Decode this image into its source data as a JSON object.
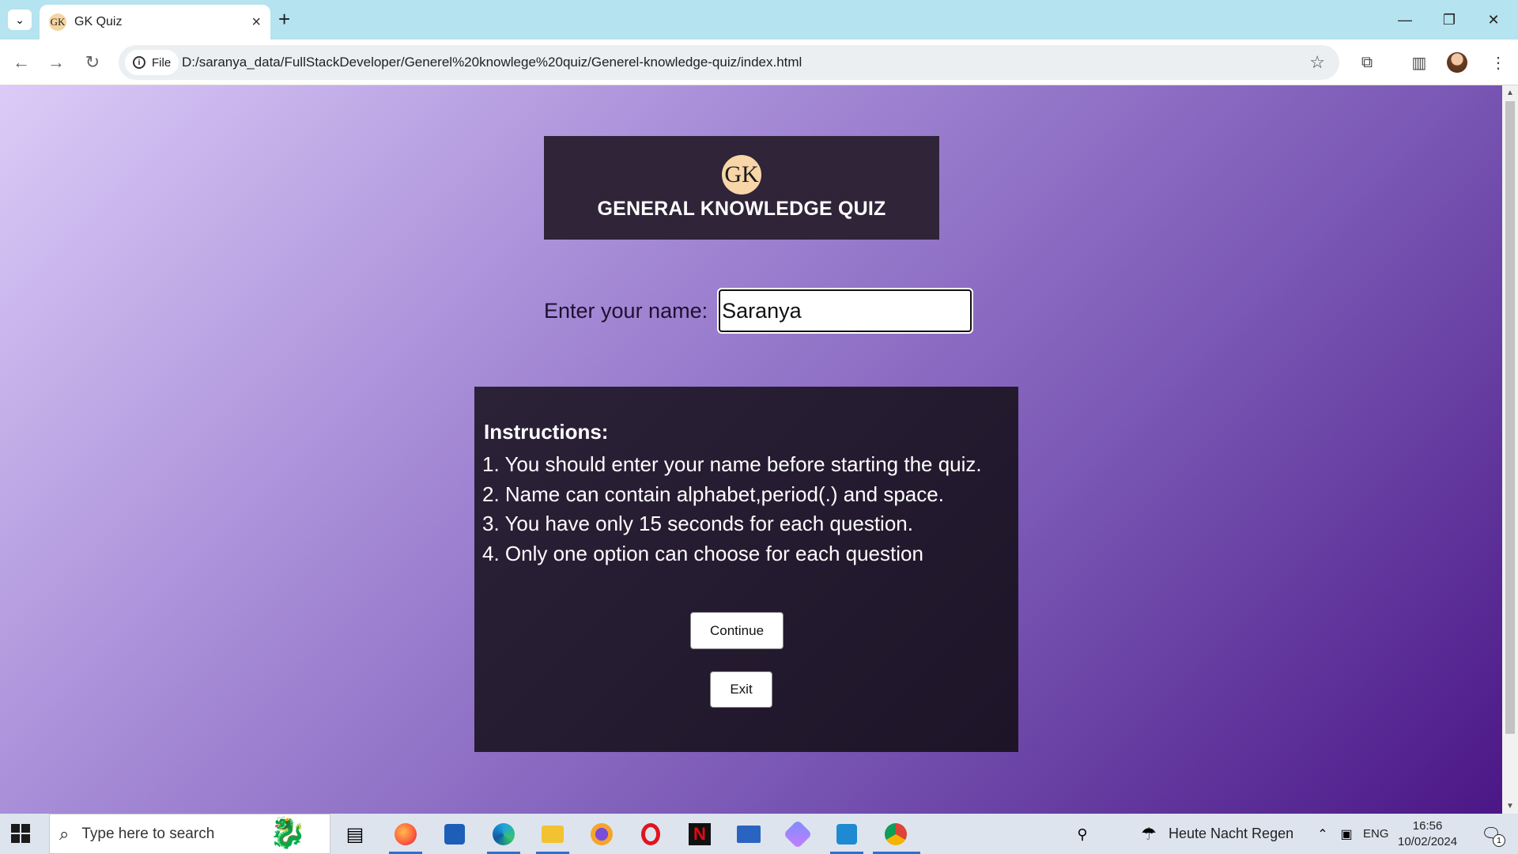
{
  "browser": {
    "tab_title": "GK Quiz",
    "tab_favicon_text": "GK",
    "omnibox_chip": "File",
    "url": "D:/saranya_data/FullStackDeveloper/Generel%20knowlege%20quiz/Generel-knowledge-quiz/index.html"
  },
  "page": {
    "logo_text": "GK",
    "title": "GENERAL KNOWLEDGE QUIZ",
    "name_label": "Enter your name:",
    "name_value": "Saranya",
    "instructions_heading": "Instructions:",
    "instructions": [
      "1. You should enter your name before starting the quiz.",
      "2. Name can contain alphabet,period(.) and space.",
      "3. You have only 15 seconds for each question.",
      "4. Only one option can choose for each question"
    ],
    "continue_label": "Continue",
    "exit_label": "Exit"
  },
  "taskbar": {
    "search_placeholder": "Type here to search",
    "weather": "Heute Nacht Regen",
    "language": "ENG",
    "time": "16:56",
    "date": "10/02/2024",
    "notification_count": "1"
  },
  "icons": {
    "taskbar_apps": [
      "task-view-icon",
      "firefox-icon",
      "store-icon",
      "edge-icon",
      "file-explorer-icon",
      "vpn-icon",
      "opera-icon",
      "netflix-icon",
      "mail-icon",
      "copilot-icon",
      "vscode-icon",
      "chrome-icon"
    ]
  }
}
